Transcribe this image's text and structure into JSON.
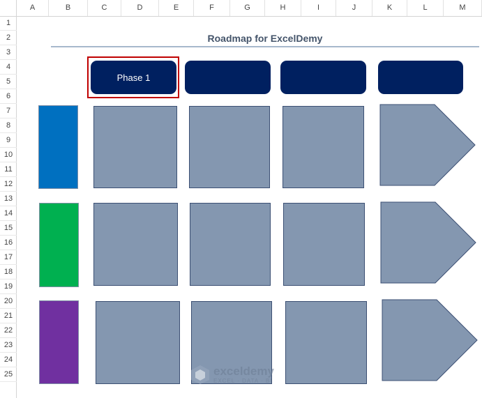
{
  "columns": [
    "A",
    "B",
    "C",
    "D",
    "E",
    "F",
    "G",
    "H",
    "I",
    "J",
    "K",
    "L",
    "M"
  ],
  "rows": [
    "1",
    "2",
    "3",
    "4",
    "5",
    "6",
    "7",
    "8",
    "9",
    "10",
    "11",
    "12",
    "13",
    "14",
    "15",
    "16",
    "17",
    "18",
    "19",
    "20",
    "21",
    "22",
    "23",
    "24",
    "25"
  ],
  "title": "Roadmap for ExcelDemy",
  "phases": [
    "Phase 1",
    "",
    "",
    ""
  ],
  "lanes": [
    {
      "color": "#0070c0"
    },
    {
      "color": "#00b050"
    },
    {
      "color": "#7030a0"
    }
  ],
  "colors": {
    "phase_fill": "#002060",
    "box_fill": "#8497b0",
    "selection_border": "#c00000"
  },
  "watermark": {
    "name": "exceldemy",
    "tagline": "EXCEL · DATA · BI",
    "icon": "exceldemy-logo-icon"
  }
}
